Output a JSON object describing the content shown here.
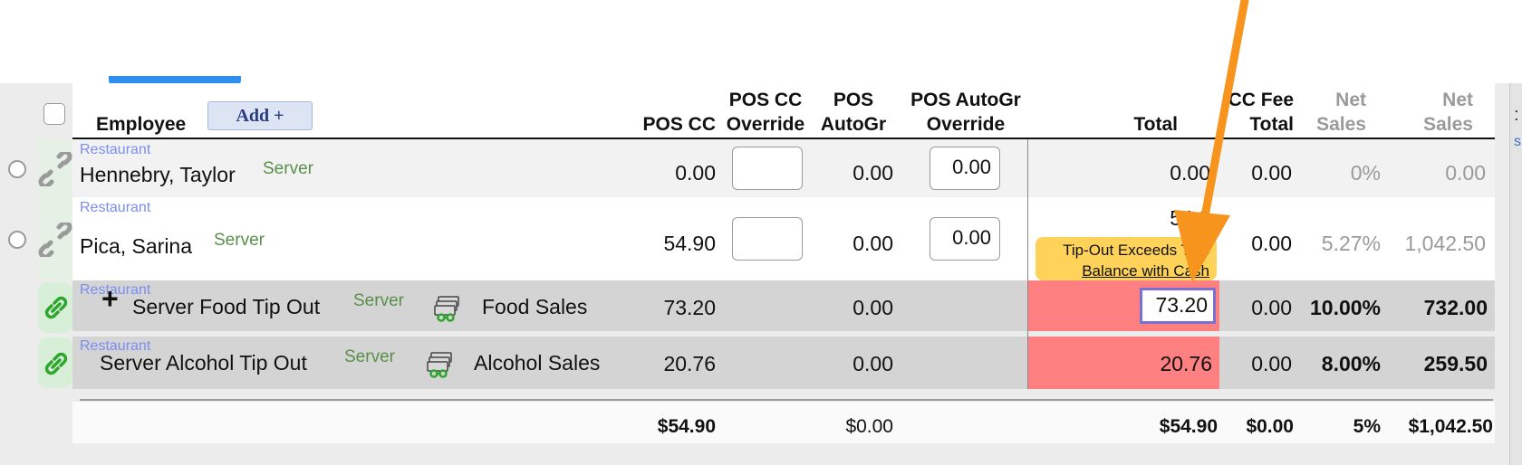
{
  "header": {
    "add_button": "Add +",
    "columns": {
      "employee": "Employee",
      "pos_cc": "POS CC",
      "pos_cc_override_1": "POS CC",
      "pos_cc_override_2": "Override",
      "pos_autogr_1": "POS",
      "pos_autogr_2": "AutoGr",
      "pos_autogr_override_1": "POS AutoGr",
      "pos_autogr_override_2": "Override",
      "total": "Total",
      "cc_fee_total_1": "CC Fee",
      "cc_fee_total_2": "Total",
      "net_sales_pct_1": "Net",
      "net_sales_pct_2": "Sales",
      "net_sales_1": "Net",
      "net_sales_2": "Sales"
    }
  },
  "rows": [
    {
      "location": "Restaurant",
      "name": "Hennebry, Taylor",
      "role": "Server",
      "pos_cc": "0.00",
      "pos_cc_override": "",
      "pos_autogr": "0.00",
      "pos_autogr_override": "0.00",
      "total": "0.00",
      "cc_fee_total": "0.00",
      "net_sales_pct": "0%",
      "net_sales": "0.00"
    },
    {
      "location": "Restaurant",
      "name": "Pica, Sarina",
      "role": "Server",
      "pos_cc": "54.90",
      "pos_cc_override": "",
      "pos_autogr": "0.00",
      "pos_autogr_override": "0.00",
      "total": "54.9",
      "warning_line1": "Tip-Out Exceeds Tips",
      "warning_line2": "Balance with Cash",
      "cc_fee_total": "0.00",
      "net_sales_pct": "5.27%",
      "net_sales": "1,042.50"
    },
    {
      "location": "Restaurant",
      "name": "Server Food Tip Out",
      "role": "Server",
      "basis": "Food Sales",
      "pos_cc": "73.20",
      "pos_autogr": "0.00",
      "total": "73.20",
      "cc_fee_total": "0.00",
      "pct": "10.00%",
      "sales": "732.00"
    },
    {
      "location": "Restaurant",
      "name": "Server Alcohol Tip Out",
      "role": "Server",
      "basis": "Alcohol Sales",
      "pos_cc": "20.76",
      "pos_autogr": "0.00",
      "total": "20.76",
      "cc_fee_total": "0.00",
      "pct": "8.00%",
      "sales": "259.50"
    }
  ],
  "totals": {
    "pos_cc": "$54.90",
    "pos_autogr": "$0.00",
    "total": "$54.90",
    "cc_fee_total": "$0.00",
    "net_sales_pct": "5%",
    "net_sales": "$1,042.50"
  },
  "colors": {
    "accent_blue": "#2f8ff0",
    "error_red": "#fe8080",
    "warning_yellow": "#ffd25a",
    "arrow_orange": "#f7941d",
    "link_green": "#2fa52f"
  },
  "icons": [
    "link-icon",
    "broken-link-icon",
    "plus-icon",
    "money-icon",
    "arrow-annotation"
  ]
}
